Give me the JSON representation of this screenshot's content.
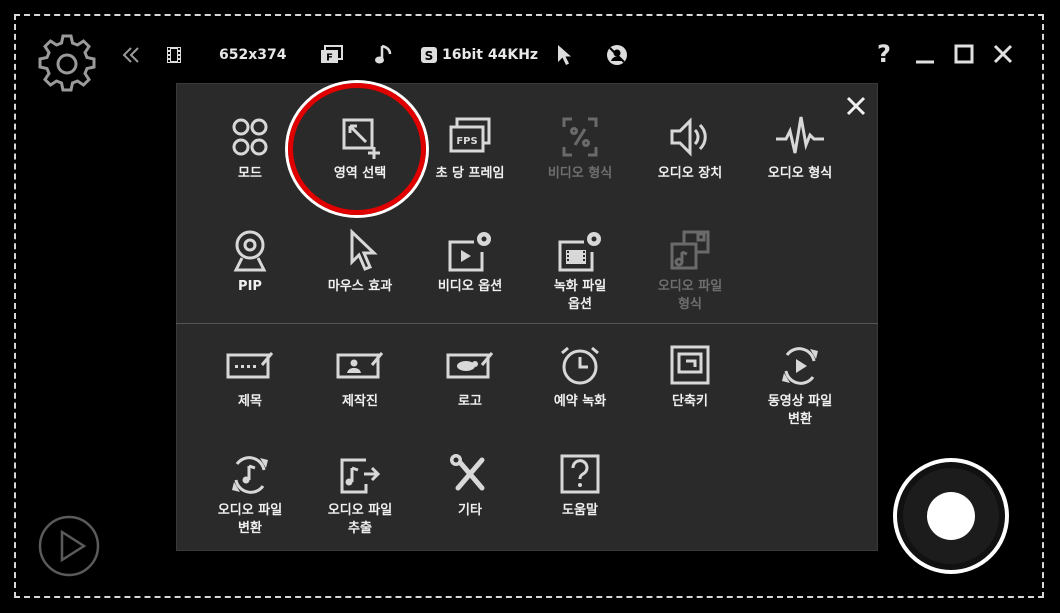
{
  "toolbar": {
    "resolution": "652x374",
    "audio_quality": "16bit 44KHz",
    "help": "?"
  },
  "menu": {
    "row1": [
      {
        "label": "모드",
        "icon": "mode-icon"
      },
      {
        "label": "영역 선택",
        "icon": "area-select-icon"
      },
      {
        "label": "초 당 프레임",
        "icon": "fps-icon"
      },
      {
        "label": "비디오 형식",
        "icon": "video-format-icon",
        "disabled": true
      },
      {
        "label": "오디오 장치",
        "icon": "speaker-icon"
      },
      {
        "label": "오디오 형식",
        "icon": "waveform-icon"
      }
    ],
    "row2": [
      {
        "label": "PIP",
        "icon": "webcam-icon"
      },
      {
        "label": "마우스 효과",
        "icon": "cursor-icon"
      },
      {
        "label": "비디오 옵션",
        "icon": "video-options-icon"
      },
      {
        "label": "녹화 파일\n옵션",
        "icon": "record-file-options-icon"
      },
      {
        "label": "오디오 파일\n형식",
        "icon": "audio-file-format-icon",
        "disabled": true
      }
    ],
    "row3": [
      {
        "label": "제목",
        "icon": "title-icon"
      },
      {
        "label": "제작진",
        "icon": "credits-icon"
      },
      {
        "label": "로고",
        "icon": "logo-icon"
      },
      {
        "label": "예약 녹화",
        "icon": "clock-icon"
      },
      {
        "label": "단축키",
        "icon": "hotkey-icon"
      },
      {
        "label": "동영상 파일\n변환",
        "icon": "video-convert-icon"
      }
    ],
    "row4": [
      {
        "label": "오디오 파일\n변환",
        "icon": "audio-convert-icon"
      },
      {
        "label": "오디오 파일\n추출",
        "icon": "audio-extract-icon"
      },
      {
        "label": "기타",
        "icon": "tools-icon"
      },
      {
        "label": "도움말",
        "icon": "help-icon"
      }
    ]
  },
  "colors": {
    "background": "#000000",
    "panel": "#2a2a2a",
    "highlight": "#e00000",
    "disabled": "#6e6e6e"
  }
}
